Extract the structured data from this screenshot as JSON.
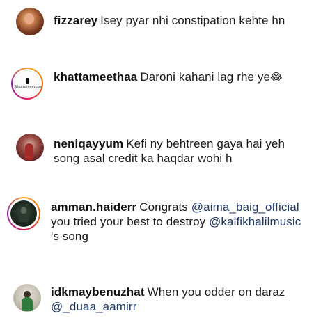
{
  "comments": [
    {
      "username": "fizzarey",
      "text": "Isey pyar nhi constipation kehte hn"
    },
    {
      "username": "khattameethaa",
      "text": "Daroni kahani lag rhe ye",
      "emoji": "😂",
      "avatar_brand": "Khattameethaa"
    },
    {
      "username": "neniqayyum",
      "text": "Kefi ny behtreen gaya hai yeh song asal credit ka haqdar wohi h"
    },
    {
      "username": "amman.haiderr",
      "text_before": "Congrats",
      "mention1": "@aima_baig_official",
      "text_middle": "you tried your best to destroy",
      "mention2": "@kaifikhalilmusic",
      "text_after": "'s song"
    },
    {
      "username": "idkmaybenuzhat",
      "text": "When you odder on daraz",
      "mention": "@_duaa_aamirr"
    }
  ],
  "colors": {
    "mention": "#1f3a68",
    "story_ring_start": "#f9a825",
    "story_ring_end": "#d81b60"
  }
}
